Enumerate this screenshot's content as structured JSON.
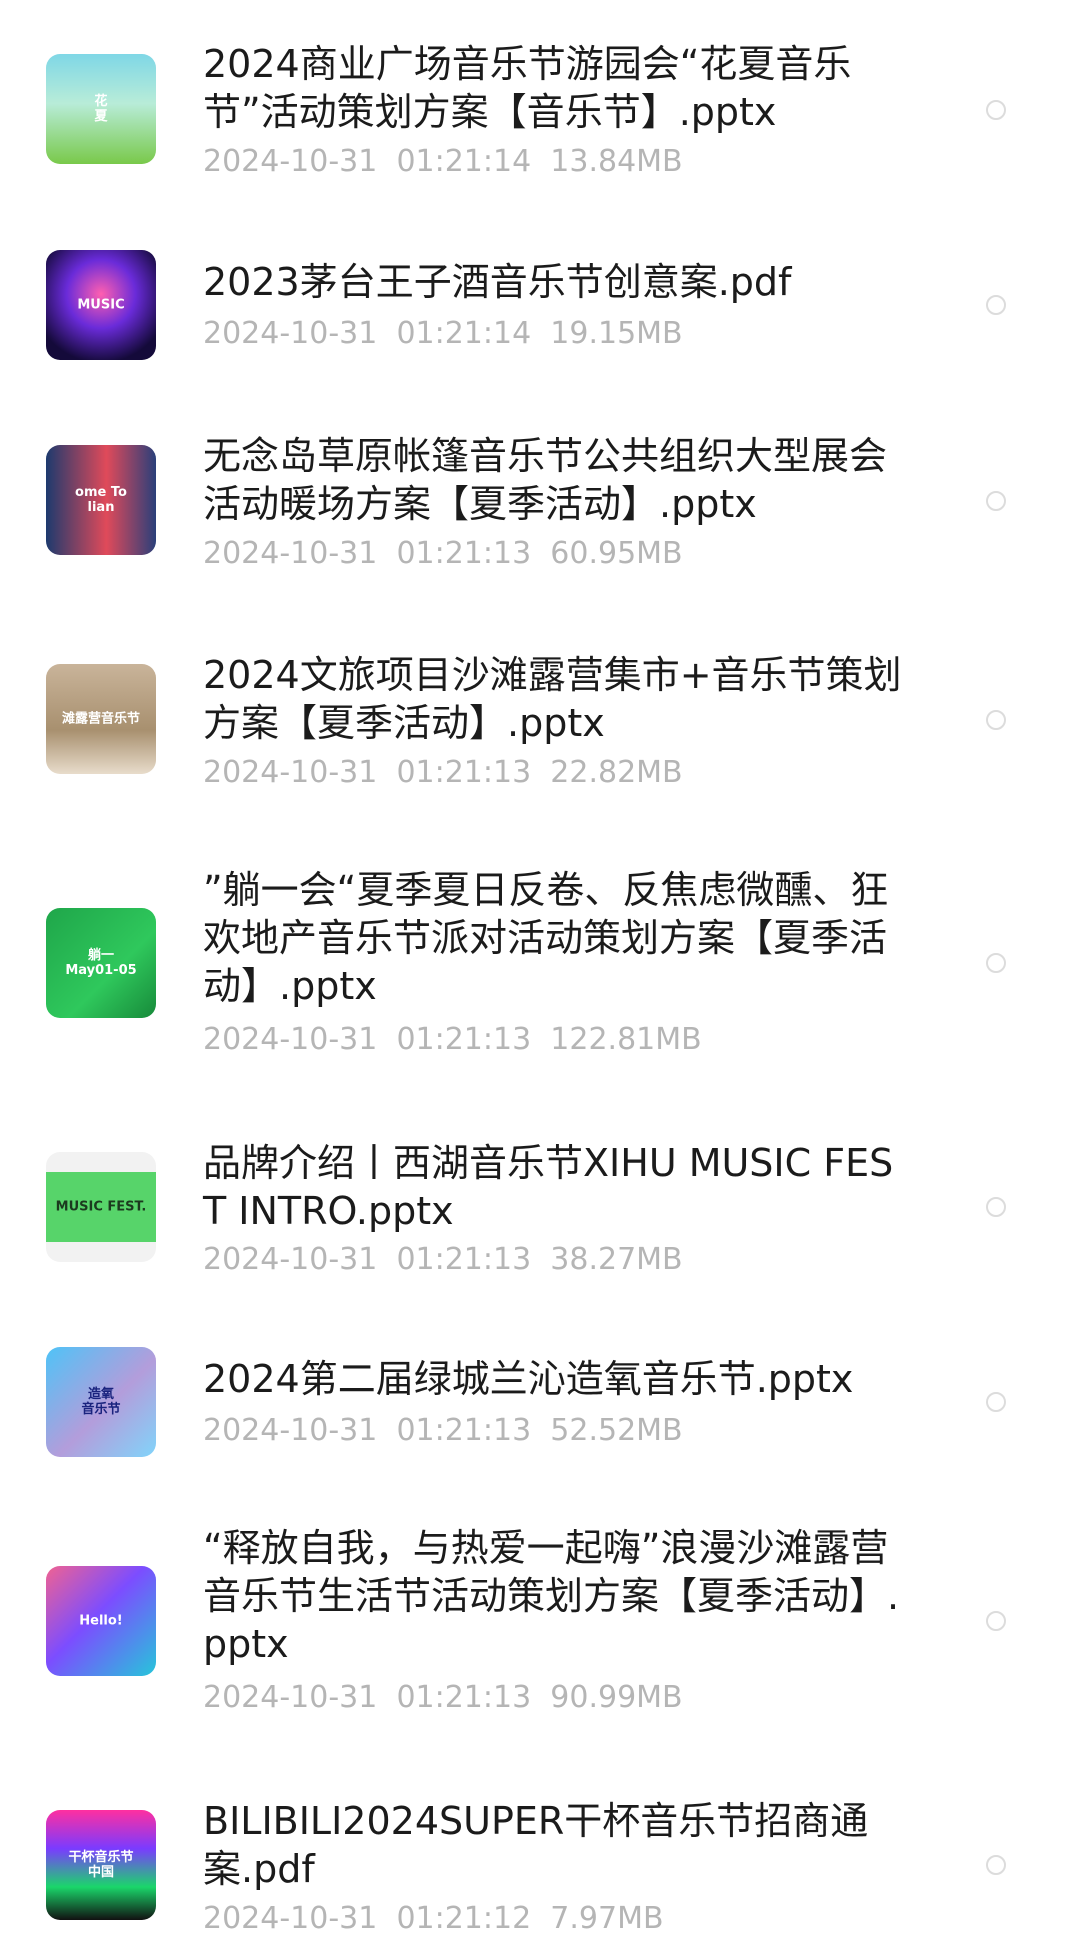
{
  "files": [
    {
      "name": "2024商业广场音乐节游园会“花夏音乐节”活动策划方案【音乐节】.pptx",
      "date": "2024-10-31",
      "time": "01:21:14",
      "size": "13.84MB",
      "thumb": {
        "bg": "linear-gradient(180deg,#7fd7e6 0%,#b8ecd8 45%,#79c94a 100%)",
        "color": "#ffffff",
        "text": "花\n夏"
      }
    },
    {
      "name": "2023茅台王子酒音乐节创意案.pdf",
      "date": "2024-10-31",
      "time": "01:21:14",
      "size": "19.15MB",
      "thumb": {
        "bg": "radial-gradient(circle at 50% 40%,#ff5fb0 0%,#6a2bd9 40%,#140a3a 80%)",
        "color": "#ffffff",
        "text": "MUSIC"
      }
    },
    {
      "name": "无念岛草原帐篷音乐节公共组织大型展会活动暖场方案【夏季活动】.pptx",
      "date": "2024-10-31",
      "time": "01:21:13",
      "size": "60.95MB",
      "thumb": {
        "bg": "linear-gradient(90deg,#1d3a6e 0%,#e04a5a 55%,#2a3f7a 100%)",
        "color": "#ffffff",
        "text": "ome To\nlian"
      }
    },
    {
      "name": "2024文旅项目沙滩露营集市+音乐节策划方案【夏季活动】.pptx",
      "date": "2024-10-31",
      "time": "01:21:13",
      "size": "22.82MB",
      "thumb": {
        "bg": "linear-gradient(180deg,#c9b49a 0%,#a8906f 60%,#e8dccb 100%)",
        "color": "#ffffff",
        "text": "滩露营音乐节"
      }
    },
    {
      "name": "”躺一会“夏季夏日反卷、反焦虑微醺、狂欢地产音乐节派对活动策划方案【夏季活动】.pptx",
      "date": "2024-10-31",
      "time": "01:21:13",
      "size": "122.81MB",
      "thumb": {
        "bg": "linear-gradient(135deg,#1fa64a 0%,#2fc85c 60%,#178a3a 100%)",
        "color": "#ffffff",
        "text": "躺一\nMay01-05"
      }
    },
    {
      "name": "品牌介绍丨西湖音乐节XIHU MUSIC FEST INTRO.pptx",
      "date": "2024-10-31",
      "time": "01:21:13",
      "size": "38.27MB",
      "thumb": {
        "bg": "linear-gradient(180deg,#f2f2f2 0%,#f2f2f2 18%,#57d46a 18%,#57d46a 82%,#f2f2f2 82%)",
        "color": "#1b3a1e",
        "text": "MUSIC FEST."
      }
    },
    {
      "name": "2024第二届绿城兰沁造氧音乐节.pptx",
      "date": "2024-10-31",
      "time": "01:21:13",
      "size": "52.52MB",
      "thumb": {
        "bg": "linear-gradient(135deg,#4fc3f7 0%,#b39ddb 55%,#81d4fa 100%)",
        "color": "#1a237e",
        "text": "造氧\n音乐节"
      }
    },
    {
      "name": "“释放自我，与热爱一起嗨”浪漫沙滩露营音乐节生活节活动策划方案【夏季活动】.pptx",
      "date": "2024-10-31",
      "time": "01:21:13",
      "size": "90.99MB",
      "thumb": {
        "bg": "linear-gradient(135deg,#f06292 0%,#7c4dff 45%,#26c6da 100%)",
        "color": "#ffffff",
        "text": "Hello!"
      }
    },
    {
      "name": "BILIBILI2024SUPER干杯音乐节招商通案.pdf",
      "date": "2024-10-31",
      "time": "01:21:12",
      "size": "7.97MB",
      "thumb": {
        "bg": "linear-gradient(180deg,#ff2fa0 0%,#7a3bff 35%,#1ad66a 70%,#111111 100%)",
        "color": "#ffffff",
        "text": "干杯音乐节\n中国"
      }
    }
  ]
}
